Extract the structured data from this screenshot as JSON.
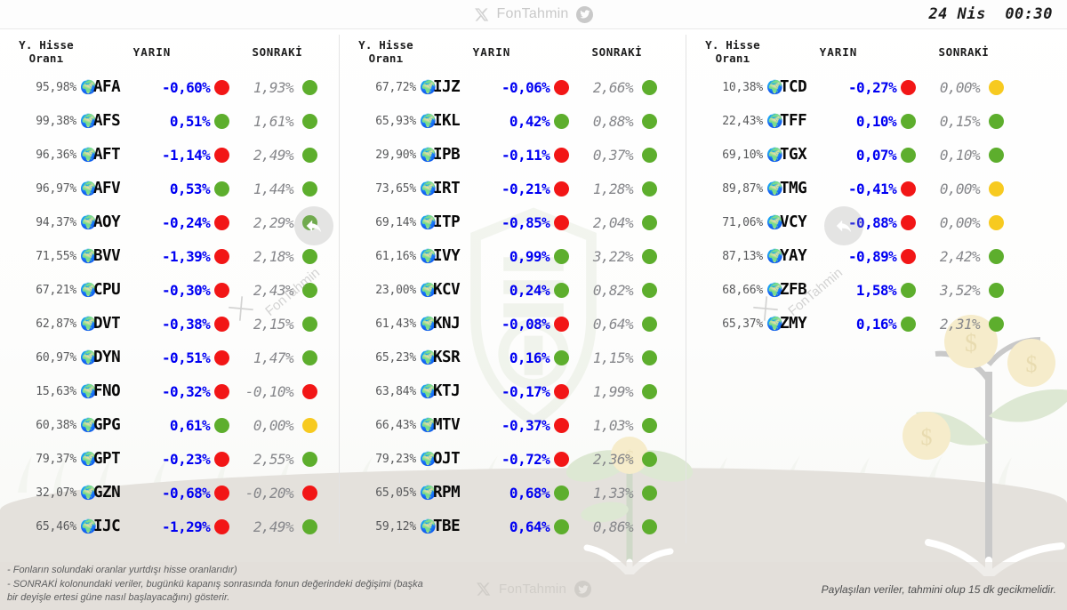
{
  "header": {
    "brand": "FonTahmin",
    "x_icon": "x-logo-icon",
    "twitter_icon": "twitter-bird-icon",
    "timestamp": "24 Nis  00:30"
  },
  "columns_headers": {
    "rate": "Y. Hisse\nOranı",
    "today": "YARIN",
    "next": "SONRAKİ"
  },
  "colors": {
    "up": "#5dae2d",
    "down": "#f21616",
    "flat": "#f7ca20",
    "today_text": "#0000f2",
    "next_text": "#86878b",
    "rate_text": "#58595b"
  },
  "columns": [
    {
      "id": "column-1",
      "rows": [
        {
          "rate": "95,98%",
          "globe": "globe-icon",
          "code": "AFA",
          "today": "-0,60%",
          "today_dot": "down",
          "next": "1,93%",
          "next_dot": "up"
        },
        {
          "rate": "99,38%",
          "globe": "globe-icon",
          "code": "AFS",
          "today": "0,51%",
          "today_dot": "up",
          "next": "1,61%",
          "next_dot": "up"
        },
        {
          "rate": "96,36%",
          "globe": "globe-icon",
          "code": "AFT",
          "today": "-1,14%",
          "today_dot": "down",
          "next": "2,49%",
          "next_dot": "up"
        },
        {
          "rate": "96,97%",
          "globe": "globe-icon",
          "code": "AFV",
          "today": "0,53%",
          "today_dot": "up",
          "next": "1,44%",
          "next_dot": "up"
        },
        {
          "rate": "94,37%",
          "globe": "globe-icon",
          "code": "AOY",
          "today": "-0,24%",
          "today_dot": "down",
          "next": "2,29%",
          "next_dot": "up"
        },
        {
          "rate": "71,55%",
          "globe": "globe-icon",
          "code": "BVV",
          "today": "-1,39%",
          "today_dot": "down",
          "next": "2,18%",
          "next_dot": "up"
        },
        {
          "rate": "67,21%",
          "globe": "globe-icon",
          "code": "CPU",
          "today": "-0,30%",
          "today_dot": "down",
          "next": "2,43%",
          "next_dot": "up"
        },
        {
          "rate": "62,87%",
          "globe": "globe-icon",
          "code": "DVT",
          "today": "-0,38%",
          "today_dot": "down",
          "next": "2,15%",
          "next_dot": "up"
        },
        {
          "rate": "60,97%",
          "globe": "globe-icon",
          "code": "DYN",
          "today": "-0,51%",
          "today_dot": "down",
          "next": "1,47%",
          "next_dot": "up"
        },
        {
          "rate": "15,63%",
          "globe": "globe-icon",
          "code": "FNO",
          "today": "-0,32%",
          "today_dot": "down",
          "next": "-0,10%",
          "next_dot": "down"
        },
        {
          "rate": "60,38%",
          "globe": "globe-icon",
          "code": "GPG",
          "today": "0,61%",
          "today_dot": "up",
          "next": "0,00%",
          "next_dot": "flat"
        },
        {
          "rate": "79,37%",
          "globe": "globe-icon",
          "code": "GPT",
          "today": "-0,23%",
          "today_dot": "down",
          "next": "2,55%",
          "next_dot": "up"
        },
        {
          "rate": "32,07%",
          "globe": "globe-icon",
          "code": "GZN",
          "today": "-0,68%",
          "today_dot": "down",
          "next": "-0,20%",
          "next_dot": "down"
        },
        {
          "rate": "65,46%",
          "globe": "globe-icon",
          "code": "IJC",
          "today": "-1,29%",
          "today_dot": "down",
          "next": "2,49%",
          "next_dot": "up"
        }
      ]
    },
    {
      "id": "column-2",
      "rows": [
        {
          "rate": "67,72%",
          "globe": "globe-icon",
          "code": "IJZ",
          "today": "-0,06%",
          "today_dot": "down",
          "next": "2,66%",
          "next_dot": "up"
        },
        {
          "rate": "65,93%",
          "globe": "globe-icon",
          "code": "IKL",
          "today": "0,42%",
          "today_dot": "up",
          "next": "0,88%",
          "next_dot": "up"
        },
        {
          "rate": "29,90%",
          "globe": "globe-icon",
          "code": "IPB",
          "today": "-0,11%",
          "today_dot": "down",
          "next": "0,37%",
          "next_dot": "up"
        },
        {
          "rate": "73,65%",
          "globe": "globe-icon",
          "code": "IRT",
          "today": "-0,21%",
          "today_dot": "down",
          "next": "1,28%",
          "next_dot": "up"
        },
        {
          "rate": "69,14%",
          "globe": "globe-icon",
          "code": "ITP",
          "today": "-0,85%",
          "today_dot": "down",
          "next": "2,04%",
          "next_dot": "up"
        },
        {
          "rate": "61,16%",
          "globe": "globe-icon",
          "code": "IVY",
          "today": "0,99%",
          "today_dot": "up",
          "next": "3,22%",
          "next_dot": "up"
        },
        {
          "rate": "23,00%",
          "globe": "globe-icon",
          "code": "KCV",
          "today": "0,24%",
          "today_dot": "up",
          "next": "0,82%",
          "next_dot": "up"
        },
        {
          "rate": "61,43%",
          "globe": "globe-icon",
          "code": "KNJ",
          "today": "-0,08%",
          "today_dot": "down",
          "next": "0,64%",
          "next_dot": "up"
        },
        {
          "rate": "65,23%",
          "globe": "globe-icon",
          "code": "KSR",
          "today": "0,16%",
          "today_dot": "up",
          "next": "1,15%",
          "next_dot": "up"
        },
        {
          "rate": "63,84%",
          "globe": "globe-icon",
          "code": "KTJ",
          "today": "-0,17%",
          "today_dot": "down",
          "next": "1,99%",
          "next_dot": "up"
        },
        {
          "rate": "66,43%",
          "globe": "globe-icon",
          "code": "MTV",
          "today": "-0,37%",
          "today_dot": "down",
          "next": "1,03%",
          "next_dot": "up"
        },
        {
          "rate": "79,23%",
          "globe": "globe-icon",
          "code": "OJT",
          "today": "-0,72%",
          "today_dot": "down",
          "next": "2,36%",
          "next_dot": "up"
        },
        {
          "rate": "65,05%",
          "globe": "globe-icon",
          "code": "RPM",
          "today": "0,68%",
          "today_dot": "up",
          "next": "1,33%",
          "next_dot": "up"
        },
        {
          "rate": "59,12%",
          "globe": "globe-icon",
          "code": "TBE",
          "today": "0,64%",
          "today_dot": "up",
          "next": "0,86%",
          "next_dot": "up"
        }
      ]
    },
    {
      "id": "column-3",
      "rows": [
        {
          "rate": "10,38%",
          "globe": "globe-icon",
          "code": "TCD",
          "today": "-0,27%",
          "today_dot": "down",
          "next": "0,00%",
          "next_dot": "flat"
        },
        {
          "rate": "22,43%",
          "globe": "globe-icon",
          "code": "TFF",
          "today": "0,10%",
          "today_dot": "up",
          "next": "0,15%",
          "next_dot": "up"
        },
        {
          "rate": "69,10%",
          "globe": "globe-icon",
          "code": "TGX",
          "today": "0,07%",
          "today_dot": "up",
          "next": "0,10%",
          "next_dot": "up"
        },
        {
          "rate": "89,87%",
          "globe": "globe-icon",
          "code": "TMG",
          "today": "-0,41%",
          "today_dot": "down",
          "next": "0,00%",
          "next_dot": "flat"
        },
        {
          "rate": "71,06%",
          "globe": "globe-icon",
          "code": "VCY",
          "today": "-0,88%",
          "today_dot": "down",
          "next": "0,00%",
          "next_dot": "flat"
        },
        {
          "rate": "87,13%",
          "globe": "globe-icon",
          "code": "YAY",
          "today": "-0,89%",
          "today_dot": "down",
          "next": "2,42%",
          "next_dot": "up"
        },
        {
          "rate": "68,66%",
          "globe": "globe-icon",
          "code": "ZFB",
          "today": "1,58%",
          "today_dot": "up",
          "next": "3,52%",
          "next_dot": "up"
        },
        {
          "rate": "65,37%",
          "globe": "globe-icon",
          "code": "ZMY",
          "today": "0,16%",
          "today_dot": "up",
          "next": "2,31%",
          "next_dot": "up"
        }
      ]
    }
  ],
  "watermarks": {
    "diagonal_text": "FonTahmin",
    "center_logo": "club-crest-watermark"
  },
  "footer": {
    "note_line1": "- Fonların solundaki oranlar yurtdışı hisse oranlarıdır)",
    "note_line2": "- SONRAKİ kolonundaki veriler, bugünkü kapanış sonrasında fonun değerindeki değişimi (başka",
    "note_line3": "bir deyişle ertesi güne nasıl başlayacağını) gösterir.",
    "brand": "FonTahmin",
    "disclaimer": "Paylaşılan veriler, tahmini olup 15 dk gecikmelidir."
  }
}
